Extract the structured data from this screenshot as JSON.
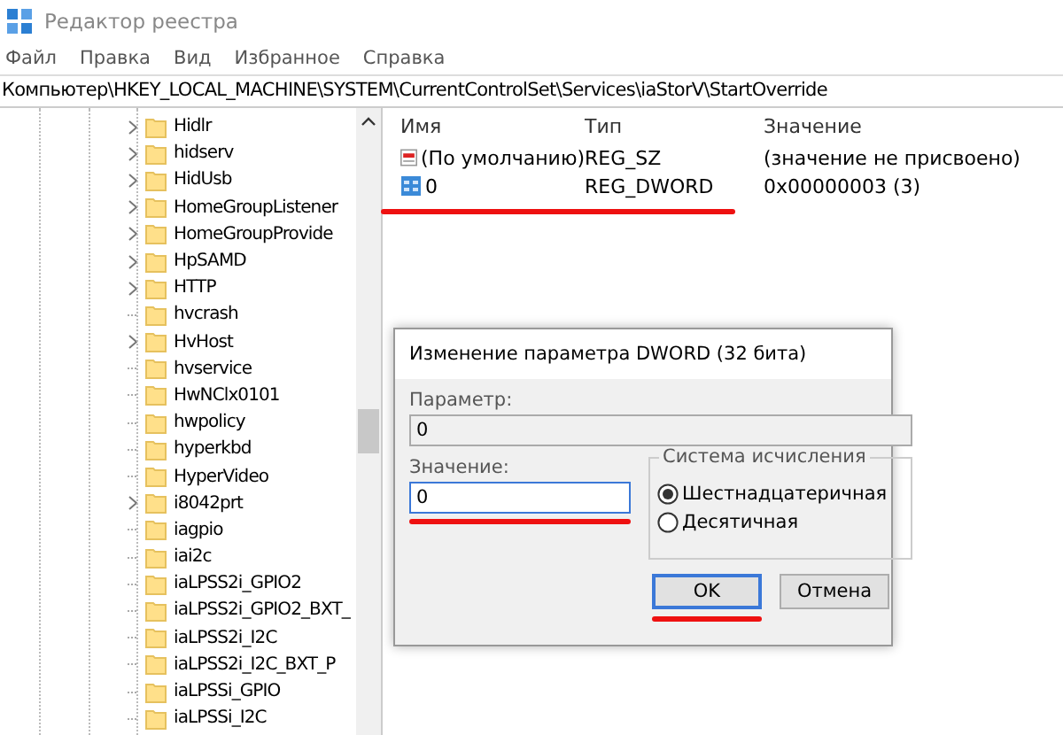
{
  "window": {
    "title": "Редактор реестра"
  },
  "menu": [
    "Файл",
    "Правка",
    "Вид",
    "Избранное",
    "Справка"
  ],
  "address": "Компьютер\\HKEY_LOCAL_MACHINE\\SYSTEM\\CurrentControlSet\\Services\\iaStorV\\StartOverride",
  "tree": [
    {
      "label": "Hidlr",
      "expandable": true
    },
    {
      "label": "hidserv",
      "expandable": true
    },
    {
      "label": "HidUsb",
      "expandable": true
    },
    {
      "label": "HomeGroupListener",
      "expandable": true
    },
    {
      "label": "HomeGroupProvide",
      "expandable": true
    },
    {
      "label": "HpSAMD",
      "expandable": true
    },
    {
      "label": "HTTP",
      "expandable": true
    },
    {
      "label": "hvcrash",
      "expandable": false
    },
    {
      "label": "HvHost",
      "expandable": true
    },
    {
      "label": "hvservice",
      "expandable": false
    },
    {
      "label": "HwNClx0101",
      "expandable": false
    },
    {
      "label": "hwpolicy",
      "expandable": false
    },
    {
      "label": "hyperkbd",
      "expandable": false
    },
    {
      "label": "HyperVideo",
      "expandable": false
    },
    {
      "label": "i8042prt",
      "expandable": true
    },
    {
      "label": "iagpio",
      "expandable": false
    },
    {
      "label": "iai2c",
      "expandable": false
    },
    {
      "label": "iaLPSS2i_GPIO2",
      "expandable": false
    },
    {
      "label": "iaLPSS2i_GPIO2_BXT_",
      "expandable": false
    },
    {
      "label": "iaLPSS2i_I2C",
      "expandable": false
    },
    {
      "label": "iaLPSS2i_I2C_BXT_P",
      "expandable": false
    },
    {
      "label": "iaLPSSi_GPIO",
      "expandable": false
    },
    {
      "label": "iaLPSSi_I2C",
      "expandable": false
    }
  ],
  "values_table": {
    "columns": [
      "Имя",
      "Тип",
      "Значение"
    ],
    "rows": [
      {
        "kind": "string",
        "name": "(По умолчанию)",
        "type": "REG_SZ",
        "data": "(значение не присвоено)"
      },
      {
        "kind": "binary",
        "name": "0",
        "type": "REG_DWORD",
        "data": "0x00000003 (3)"
      }
    ]
  },
  "dialog": {
    "title": "Изменение параметра DWORD (32 бита)",
    "param_label": "Параметр:",
    "param_value": "0",
    "value_label": "Значение:",
    "value": "0",
    "base_group": "Система исчисления",
    "bases": [
      {
        "label": "Шестнадцатеричная",
        "selected": true
      },
      {
        "label": "Десятичная",
        "selected": false
      }
    ],
    "buttons": [
      {
        "label": "OK",
        "default": true
      },
      {
        "label": "Отмена",
        "default": false
      }
    ]
  }
}
